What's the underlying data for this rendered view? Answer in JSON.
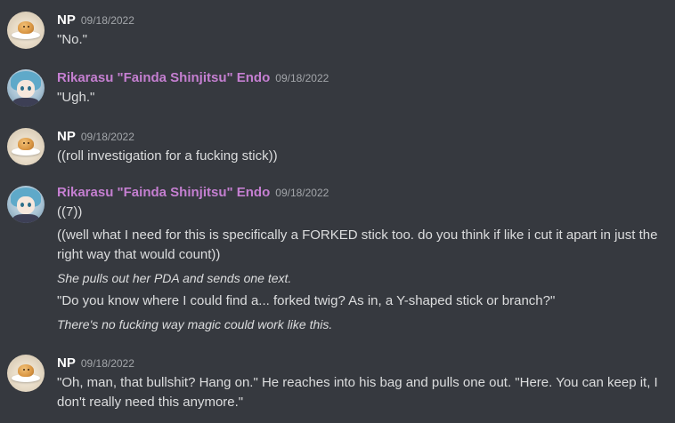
{
  "messages": [
    {
      "author": "NP",
      "timestamp": "09/18/2022",
      "avatar": "np-avatar",
      "lines": [
        {
          "text": "\"No.\"",
          "italic": false
        }
      ]
    },
    {
      "author": "Rikarasu \"Fainda Shinjitsu\" Endo",
      "timestamp": "09/18/2022",
      "avatar": "rikarasu-avatar",
      "lines": [
        {
          "text": "\"Ugh.\"",
          "italic": false
        }
      ]
    },
    {
      "author": "NP",
      "timestamp": "09/18/2022",
      "avatar": "np-avatar",
      "lines": [
        {
          "text": "((roll investigation for a fucking stick))",
          "italic": false
        }
      ]
    },
    {
      "author": "Rikarasu \"Fainda Shinjitsu\" Endo",
      "timestamp": "09/18/2022",
      "avatar": "rikarasu-avatar",
      "lines": [
        {
          "text": "((7))",
          "italic": false
        },
        {
          "text": "((well what I need for this is specifically a FORKED stick too. do you think if like i cut it apart in just the right way that would count))",
          "italic": false
        },
        {
          "text": "She pulls out her PDA and sends one text.",
          "italic": true
        },
        {
          "text": "\"Do you know where I could find a... forked twig? As in, a Y-shaped stick or branch?\"",
          "italic": false
        },
        {
          "text": "There's no fucking way magic could work like this.",
          "italic": true
        }
      ]
    },
    {
      "author": "NP",
      "timestamp": "09/18/2022",
      "avatar": "np-avatar",
      "lines": [
        {
          "text": "\"Oh, man, that bullshit? Hang on.\" He reaches into his bag and pulls one out. \"Here. You can keep it, I don't really need this anymore.\"",
          "italic": false
        }
      ]
    }
  ],
  "colors": {
    "background": "#36393f",
    "np_name": "#ffffff",
    "rikarasu_name": "#c57fd1",
    "message_text": "#dcddde",
    "timestamp": "#a3a6aa"
  }
}
